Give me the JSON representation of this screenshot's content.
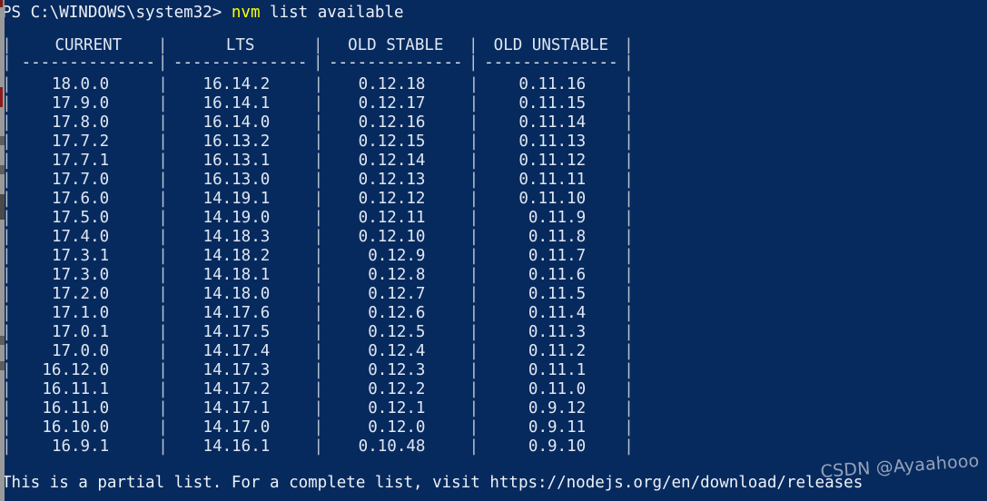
{
  "terminal": {
    "background_color": "#072a5e",
    "foreground_color": "#dfe7f2",
    "highlight_color": "#ffff00"
  },
  "prompt": {
    "path": "PS C:\\WINDOWS\\system32> ",
    "command_name": "nvm",
    "command_args": " list available",
    "full_line": "PS C:\\WINDOWS\\system32> nvm list available"
  },
  "table": {
    "headers": [
      "CURRENT",
      "LTS",
      "OLD STABLE",
      "OLD UNSTABLE"
    ],
    "separator": "|",
    "underline": "--------------",
    "rows": [
      [
        "18.0.0",
        "16.14.2",
        "0.12.18",
        "0.11.16"
      ],
      [
        "17.9.0",
        "16.14.1",
        "0.12.17",
        "0.11.15"
      ],
      [
        "17.8.0",
        "16.14.0",
        "0.12.16",
        "0.11.14"
      ],
      [
        "17.7.2",
        "16.13.2",
        "0.12.15",
        "0.11.13"
      ],
      [
        "17.7.1",
        "16.13.1",
        "0.12.14",
        "0.11.12"
      ],
      [
        "17.7.0",
        "16.13.0",
        "0.12.13",
        "0.11.11"
      ],
      [
        "17.6.0",
        "14.19.1",
        "0.12.12",
        "0.11.10"
      ],
      [
        "17.5.0",
        "14.19.0",
        "0.12.11",
        "0.11.9"
      ],
      [
        "17.4.0",
        "14.18.3",
        "0.12.10",
        "0.11.8"
      ],
      [
        "17.3.1",
        "14.18.2",
        "0.12.9",
        "0.11.7"
      ],
      [
        "17.3.0",
        "14.18.1",
        "0.12.8",
        "0.11.6"
      ],
      [
        "17.2.0",
        "14.18.0",
        "0.12.7",
        "0.11.5"
      ],
      [
        "17.1.0",
        "14.17.6",
        "0.12.6",
        "0.11.4"
      ],
      [
        "17.0.1",
        "14.17.5",
        "0.12.5",
        "0.11.3"
      ],
      [
        "17.0.0",
        "14.17.4",
        "0.12.4",
        "0.11.2"
      ],
      [
        "16.12.0",
        "14.17.3",
        "0.12.3",
        "0.11.1"
      ],
      [
        "16.11.1",
        "14.17.2",
        "0.12.2",
        "0.11.0"
      ],
      [
        "16.11.0",
        "14.17.1",
        "0.12.1",
        "0.9.12"
      ],
      [
        "16.10.0",
        "14.17.0",
        "0.12.0",
        "0.9.11"
      ],
      [
        "16.9.1",
        "14.16.1",
        "0.10.48",
        "0.9.10"
      ]
    ]
  },
  "footer": {
    "text": "This is a partial list. For a complete list, visit https://nodejs.org/en/download/releases"
  },
  "watermark": {
    "text": "CSDN @Ayaahooo"
  }
}
